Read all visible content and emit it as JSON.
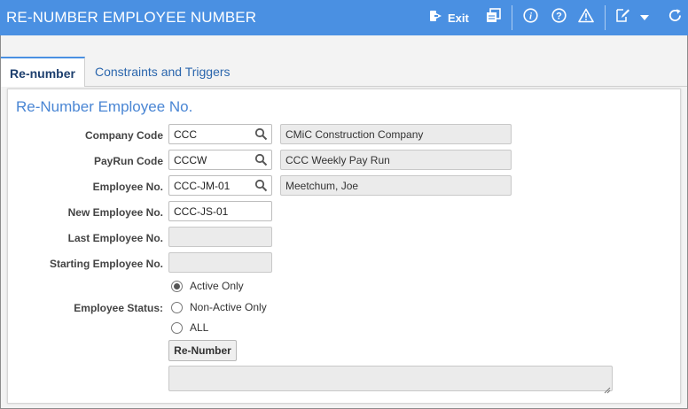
{
  "window": {
    "title": "RE-NUMBER EMPLOYEE NUMBER"
  },
  "toolbar": {
    "exit_label": "Exit",
    "icons": [
      "exit-icon",
      "copy-icon",
      "info-icon",
      "help-icon",
      "warning-icon",
      "edit-icon",
      "chevron-down-icon",
      "refresh-icon"
    ]
  },
  "tabs": [
    {
      "label": "Re-number",
      "active": true
    },
    {
      "label": "Constraints and Triggers",
      "active": false
    }
  ],
  "form": {
    "section_title": "Re-Number Employee No.",
    "company_code": {
      "label": "Company Code",
      "value": "CCC",
      "description": "CMiC Construction Company"
    },
    "payrun_code": {
      "label": "PayRun Code",
      "value": "CCCW",
      "description": "CCC Weekly Pay Run"
    },
    "employee_no": {
      "label": "Employee No.",
      "value": "CCC-JM-01",
      "description": "Meetchum, Joe"
    },
    "new_employee_no": {
      "label": "New Employee No.",
      "value": "CCC-JS-01"
    },
    "last_employee_no": {
      "label": "Last Employee No.",
      "value": ""
    },
    "starting_employee_no": {
      "label": "Starting Employee No.",
      "value": ""
    },
    "employee_status": {
      "label": "Employee Status:",
      "options": [
        "Active Only",
        "Non-Active Only",
        "ALL"
      ],
      "selected": "Active Only"
    },
    "renumber_button": "Re-Number"
  },
  "colors": {
    "accent": "#4a90e2",
    "section_title": "#4a86d4",
    "tab_text": "#2b66ad"
  }
}
